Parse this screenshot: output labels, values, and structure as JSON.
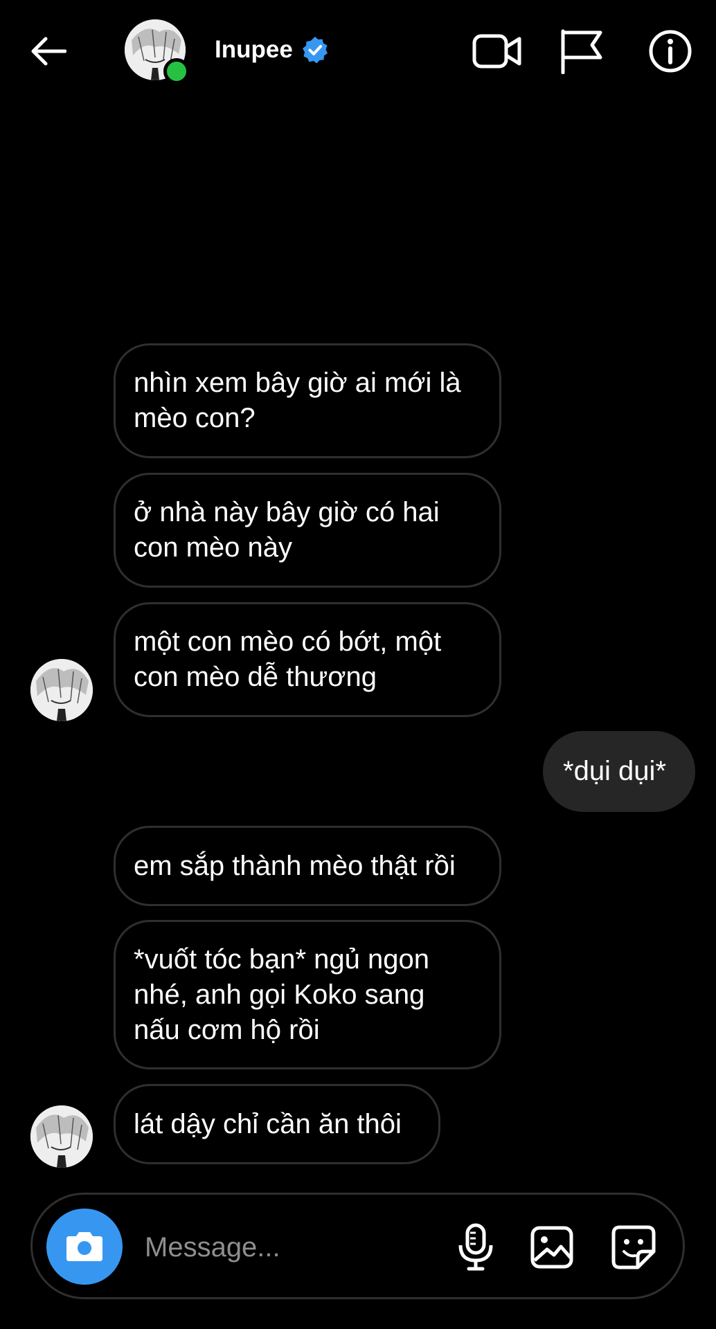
{
  "header": {
    "username": "Inupee",
    "online": true,
    "icons": [
      "back-arrow-icon",
      "avatar",
      "verified-badge-icon",
      "video-call-icon",
      "flag-icon",
      "info-icon"
    ]
  },
  "messages": [
    {
      "direction": "received",
      "lines": [
        "nhìn xem bây giờ ai mới là",
        "mèo con?"
      ]
    },
    {
      "direction": "received",
      "lines": [
        "ở nhà này bây giờ có hai",
        "con mèo này"
      ]
    },
    {
      "direction": "received",
      "lines": [
        "một con mèo có bớt, một",
        "con mèo dễ thương"
      ],
      "show_avatar": true
    },
    {
      "direction": "sent",
      "lines": [
        "*dụi dụi*"
      ]
    },
    {
      "direction": "received",
      "lines": [
        "em sắp thành mèo thật rồi"
      ]
    },
    {
      "direction": "received",
      "lines": [
        "*vuốt tóc bạn* ngủ ngon",
        "nhé, anh gọi Koko sang",
        "nấu cơm hộ rồi"
      ]
    },
    {
      "direction": "received",
      "lines": [
        "lát dậy chỉ cần ăn thôi"
      ],
      "show_avatar": true
    }
  ],
  "composer": {
    "placeholder": "Message...",
    "value": "",
    "icons": [
      "camera-icon",
      "microphone-icon",
      "gallery-icon",
      "sticker-icon"
    ]
  },
  "colors": {
    "background": "#000000",
    "bubble_border": "#2f2f2f",
    "sent_bubble": "#262626",
    "accent": "#3797f0",
    "online": "#26c143",
    "placeholder": "#8e8e8e"
  }
}
